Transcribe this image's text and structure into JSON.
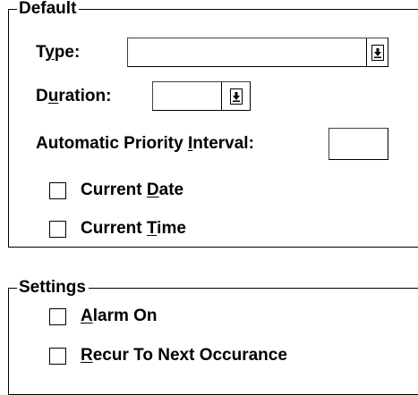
{
  "default_group": {
    "title": "Default",
    "type": {
      "label_pre": "T",
      "label_u": "y",
      "label_post": "pe:",
      "value": ""
    },
    "duration": {
      "label_pre": "D",
      "label_u": "u",
      "label_post": "ration:",
      "value": ""
    },
    "auto_priority": {
      "label_pre": "Automatic Priority ",
      "label_u": "I",
      "label_post": "nterval:",
      "value": ""
    },
    "current_date": {
      "label_pre": "Current ",
      "label_u": "D",
      "label_post": "ate",
      "checked": false
    },
    "current_time": {
      "label_pre": "Current ",
      "label_u": "T",
      "label_post": "ime",
      "checked": false
    }
  },
  "settings_group": {
    "title": "Settings",
    "alarm_on": {
      "label_u": "A",
      "label_post": "larm On",
      "checked": false
    },
    "recur": {
      "label_u": "R",
      "label_post": "ecur To Next Occurance",
      "checked": false
    }
  },
  "icons": {
    "dropdown": "down-arrow-icon"
  }
}
